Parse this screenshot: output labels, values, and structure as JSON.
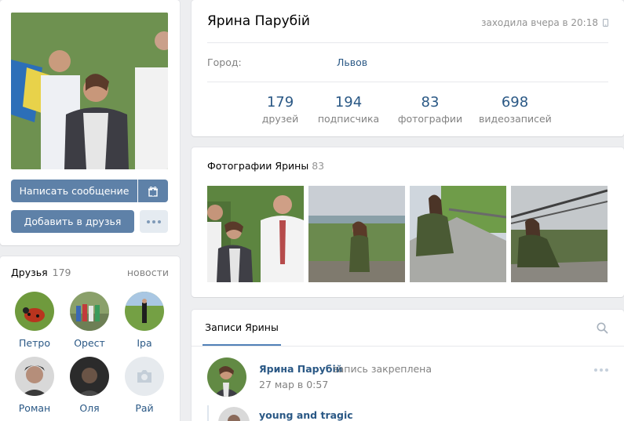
{
  "profile": {
    "name": "Ярина Парубій",
    "last_seen": "заходила вчера в 20:18",
    "city_label": "Город:",
    "city_value": "Львов",
    "counters": [
      {
        "num": "179",
        "label": "друзей"
      },
      {
        "num": "194",
        "label": "подписчика"
      },
      {
        "num": "83",
        "label": "фотографии"
      },
      {
        "num": "698",
        "label": "видеозаписей"
      }
    ]
  },
  "actions": {
    "message_label": "Написать сообщение",
    "add_friend_label": "Добавить в друзья"
  },
  "friends": {
    "title": "Друзья",
    "count": "179",
    "news_link": "новости",
    "items": [
      {
        "name": "Петро"
      },
      {
        "name": "Орест"
      },
      {
        "name": "Іра"
      },
      {
        "name": "Роман"
      },
      {
        "name": "Оля"
      },
      {
        "name": "Рай"
      }
    ]
  },
  "photos": {
    "title": "Фотографии Ярины",
    "count": "83"
  },
  "wall": {
    "tab_label": "Записи Ярины",
    "post": {
      "author": "Ярина Парубій",
      "pinned_text": "запись закреплена",
      "date": "27 мар в 0:57",
      "repost_name": "young and tragic"
    }
  },
  "colors": {
    "background": "#edeef0",
    "button_blue": "#5e81a8",
    "link": "#2a5885",
    "muted": "#828282"
  },
  "icons": [
    "gift-icon",
    "more-icon",
    "phone-icon",
    "search-icon",
    "camera-icon"
  ]
}
